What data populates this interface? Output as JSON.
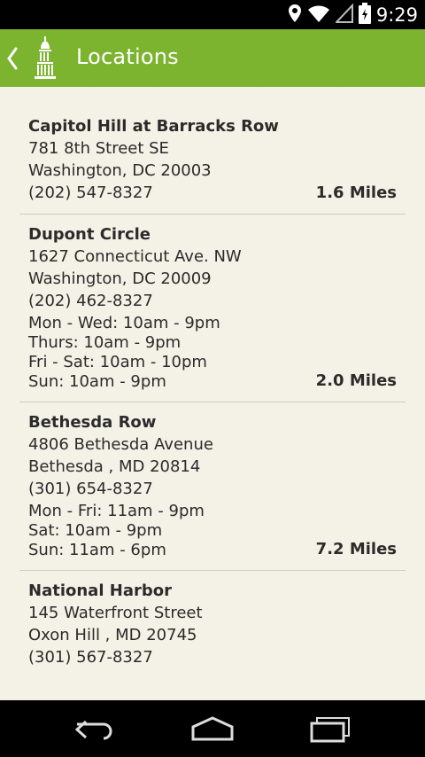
{
  "status": {
    "time": "9:29"
  },
  "header": {
    "title": "Locations"
  },
  "locations": [
    {
      "name": "Capitol Hill at Barracks Row",
      "address": "781 8th Street SE",
      "city": "Washington, DC 20003",
      "phone": "(202) 547-8327",
      "hours": [],
      "distance": "1.6 Miles"
    },
    {
      "name": "Dupont Circle",
      "address": "1627 Connecticut Ave. NW",
      "city": "Washington, DC 20009",
      "phone": "(202) 462-8327",
      "hours": [
        "Mon - Wed: 10am - 9pm",
        "Thurs: 10am - 9pm",
        "Fri - Sat: 10am - 10pm",
        "Sun: 10am - 9pm"
      ],
      "distance": "2.0 Miles"
    },
    {
      "name": "Bethesda Row",
      "address": "4806 Bethesda Avenue",
      "city": "Bethesda , MD 20814",
      "phone": "(301) 654-8327",
      "hours": [
        "Mon - Fri: 11am - 9pm",
        "Sat: 10am - 9pm",
        "Sun: 11am - 6pm"
      ],
      "distance": "7.2 Miles"
    },
    {
      "name": "National Harbor",
      "address": "145 Waterfront Street",
      "city": "Oxon Hill , MD 20745",
      "phone": "(301) 567-8327",
      "hours": [],
      "distance": ""
    }
  ],
  "colors": {
    "accent": "#7cb32f",
    "background": "#f4f1e6",
    "text": "#2b2b2b"
  },
  "icons": {
    "status": [
      "location-icon",
      "wifi-icon",
      "signal-icon",
      "battery-icon"
    ],
    "nav": [
      "back-icon",
      "home-icon",
      "recents-icon"
    ]
  }
}
